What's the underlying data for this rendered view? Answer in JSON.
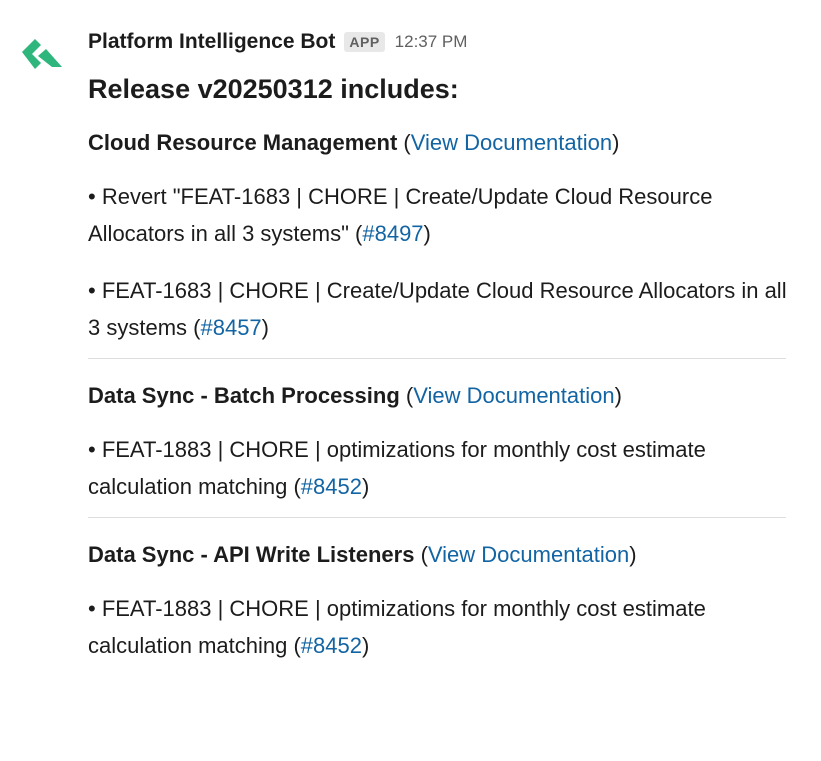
{
  "message": {
    "bot_name": "Platform Intelligence Bot",
    "badge": "APP",
    "timestamp": "12:37 PM",
    "title": "Release v20250312 includes:",
    "brand_color": "#2eb67d",
    "link_color": "#1264a3",
    "avatar_icon": "green-chevron-logo-icon"
  },
  "sections": [
    {
      "name": "Cloud Resource Management",
      "doc_link": "View Documentation",
      "items": [
        {
          "text": "• Revert \"FEAT-1683 | CHORE | Create/Update Cloud Resource Allocators in all 3 systems\"",
          "pr": "#8497"
        },
        {
          "text": "• FEAT-1683 | CHORE | Create/Update Cloud Resource Allocators in all 3 systems",
          "pr": "#8457"
        }
      ]
    },
    {
      "name": "Data Sync - Batch Processing",
      "doc_link": "View Documentation",
      "items": [
        {
          "text": "• FEAT-1883 | CHORE | optimizations for monthly cost estimate calculation matching",
          "pr": "#8452"
        }
      ]
    },
    {
      "name": "Data Sync - API Write Listeners",
      "doc_link": "View Documentation",
      "items": [
        {
          "text": "• FEAT-1883 | CHORE | optimizations for monthly cost estimate calculation matching",
          "pr": "#8452"
        }
      ]
    }
  ]
}
